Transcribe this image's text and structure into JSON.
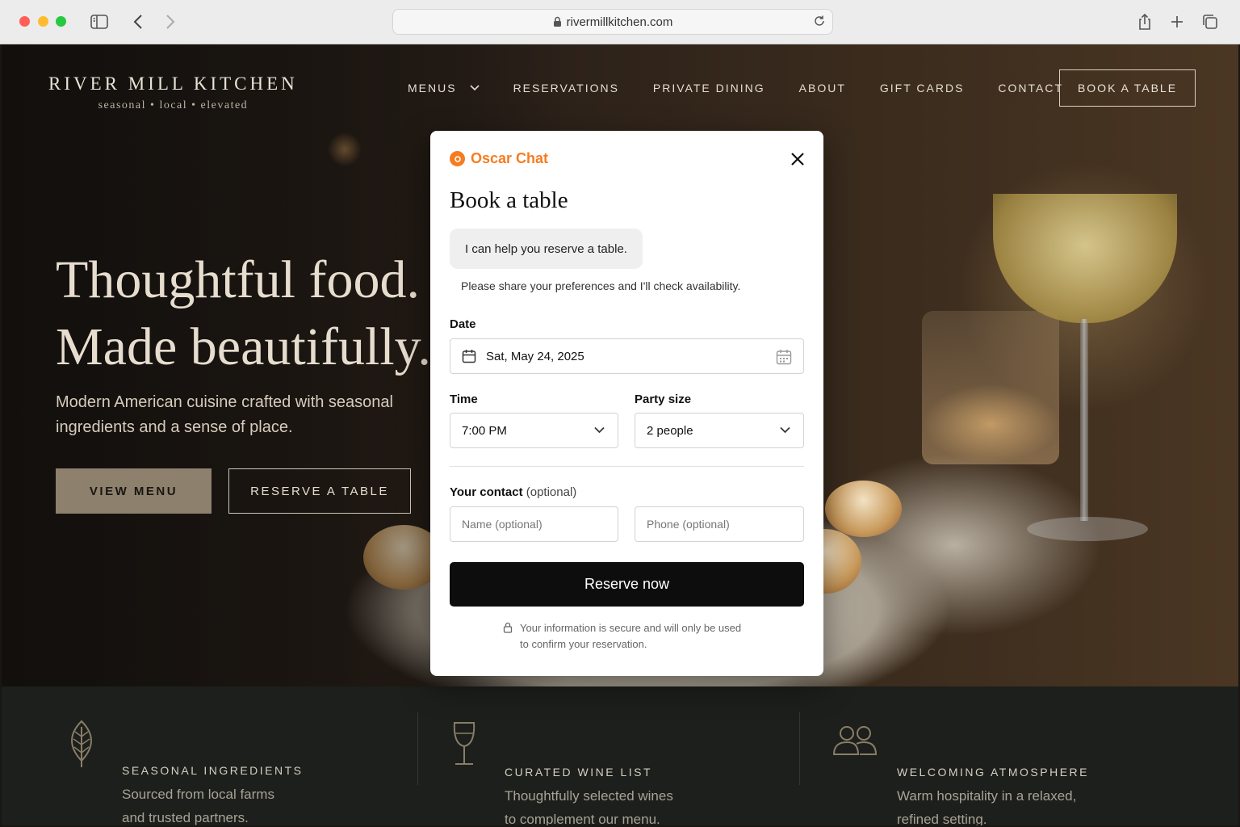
{
  "browser": {
    "url": "rivermillkitchen.com"
  },
  "site": {
    "brand_name": "RIVER MILL KITCHEN",
    "tagline": "seasonal • local • elevated",
    "nav": [
      "MENUS",
      "RESERVATIONS",
      "PRIVATE DINING",
      "ABOUT",
      "GIFT CARDS",
      "CONTACT"
    ],
    "book_button": "BOOK A TABLE"
  },
  "hero": {
    "headline_line1": "Thoughtful food.",
    "headline_line2": "Made beautifully.",
    "subhead": "Modern American cuisine crafted with seasonal ingredients and a sense of place.",
    "view_menu": "VIEW MENU",
    "reserve": "RESERVE A TABLE"
  },
  "features": [
    {
      "icon": "leaf-icon",
      "title": "SEASONAL INGREDIENTS",
      "desc_line1": "Sourced from local farms",
      "desc_line2": "and trusted partners."
    },
    {
      "icon": "wine-glass-icon",
      "title": "CURATED WINE LIST",
      "desc_line1": "Thoughtfully selected wines",
      "desc_line2": "to complement our menu."
    },
    {
      "icon": "people-icon",
      "title": "WELCOMING ATMOSPHERE",
      "desc_line1": "Warm hospitality in a relaxed,",
      "desc_line2": "refined setting."
    }
  ],
  "modal": {
    "brand": "Oscar Chat",
    "title": "Book a table",
    "bubble": "I can help you reserve a table.",
    "message": "Please share your preferences and I'll check availability.",
    "date_label": "Date",
    "date_value": "Sat, May 24, 2025",
    "time_label": "Time",
    "time_value": "7:00 PM",
    "party_label": "Party size",
    "party_value": "2 people",
    "contact_label": "Your contact",
    "contact_optional": "(optional)",
    "name_placeholder": "Name (optional)",
    "phone_placeholder": "Phone (optional)",
    "submit": "Reserve now",
    "secure_line1": "Your information is secure and will only be used",
    "secure_line2": "to confirm your reservation."
  },
  "colors": {
    "accent_orange": "#f57c21",
    "hero_button": "#8d806d",
    "submit_button": "#0d0d0d",
    "feature_band": "#1c1f1b"
  }
}
